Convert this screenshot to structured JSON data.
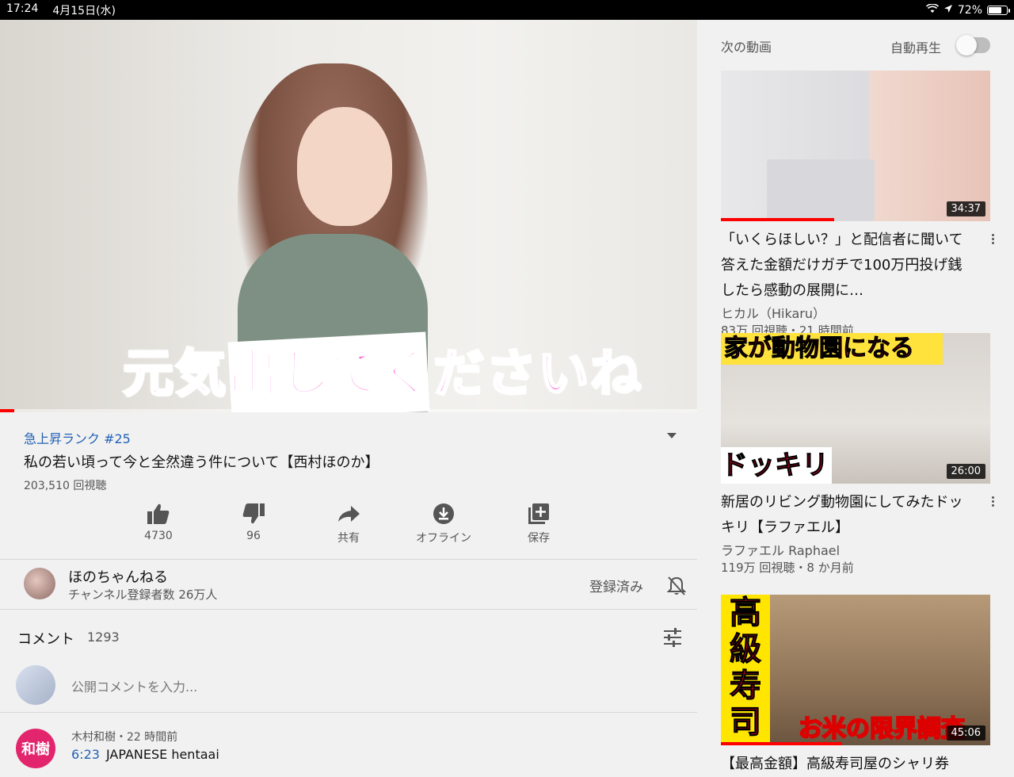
{
  "status": {
    "time": "17:24",
    "date": "4月15日(水)",
    "battery": "72%",
    "battery_level": 0.72
  },
  "player": {
    "caption": "元気出してくださいね",
    "progress": 0.02
  },
  "video": {
    "trend": "急上昇ランク #25",
    "title": "私の若い頃って今と全然違う件について【西村ほのか】",
    "views": "203,510 回視聴",
    "actions": [
      {
        "icon": "thumbs-up-icon",
        "label": "4730"
      },
      {
        "icon": "thumbs-down-icon",
        "label": "96"
      },
      {
        "icon": "share-icon",
        "label": "共有"
      },
      {
        "icon": "download-icon",
        "label": "オフライン"
      },
      {
        "icon": "save-playlist-icon",
        "label": "保存"
      }
    ]
  },
  "channel": {
    "name": "ほのちゃんねる",
    "subs": "チャンネル登録者数 26万人",
    "subscribed": "登録済み"
  },
  "comments": {
    "title": "コメント",
    "count": "1293",
    "placeholder": "公開コメントを入力...",
    "first": {
      "avatar": "和樹",
      "meta": "木村和樹・22 時間前",
      "timestamp": "6:23",
      "text": "JAPANESE hentaai"
    }
  },
  "sidebar": {
    "up_next": "次の動画",
    "autoplay": "自動再生",
    "autoplay_on": false,
    "cards": [
      {
        "title": "「いくらほしい？」と配信者に聞いて答えた金額だけガチで100万円投げ銭したら感動の展開に…",
        "channel": "ヒカル（Hikaru）",
        "meta": "83万 回視聴・21 時間前",
        "duration": "34:37",
        "watched": 0.42
      },
      {
        "title": "新居のリビング動物園にしてみたドッキリ【ラファエル】",
        "channel": "ラファエル Raphael",
        "meta": "119万 回視聴・8 か月前",
        "duration": "26:00",
        "watched": 0,
        "banner": "家が動物園になる",
        "overlay": "ドッキリ"
      },
      {
        "title": "【最高金額】高級寿司屋のシャリ券",
        "channel": "",
        "meta": "",
        "duration": "45:06",
        "watched": 0.45,
        "banner": "高級寿司",
        "overlay": "お米の限界調査"
      }
    ]
  }
}
